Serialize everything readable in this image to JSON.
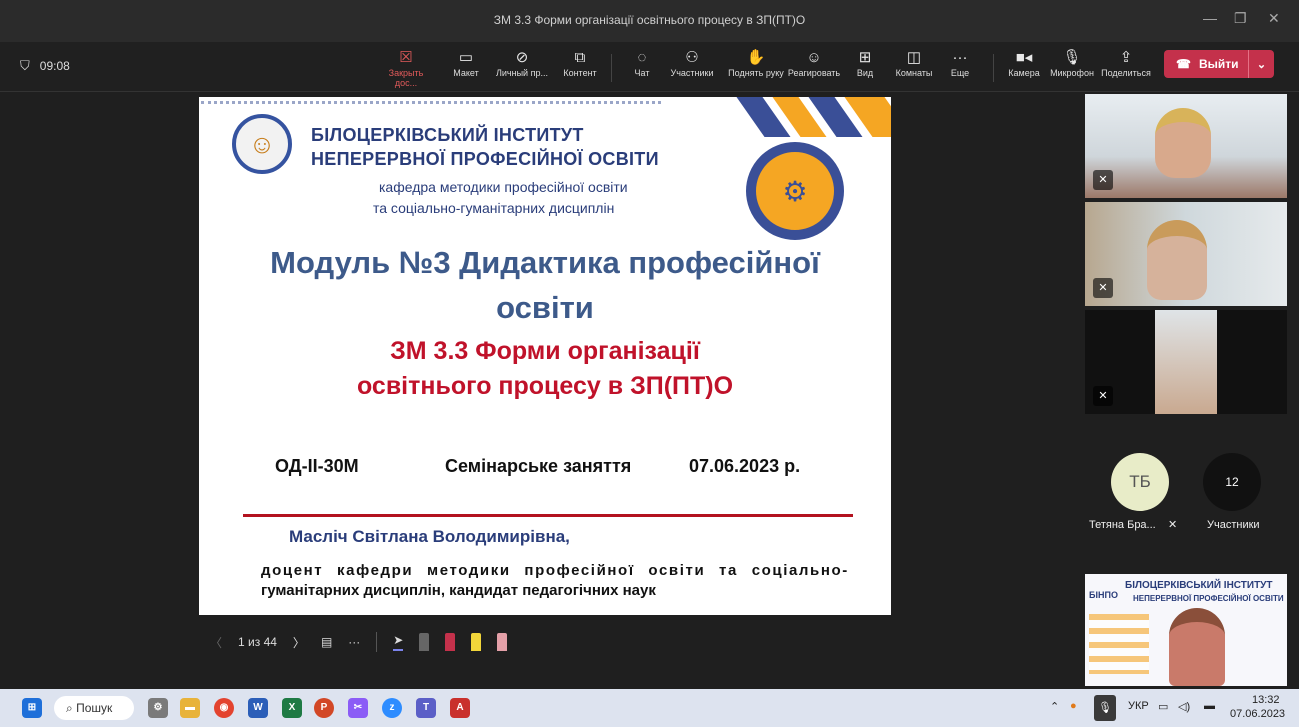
{
  "window": {
    "title": "ЗМ 3.3 Форми організації освітнього процесу в ЗП(ПТ)О"
  },
  "meeting": {
    "time": "09:08"
  },
  "toolbar": {
    "stop_share": "Закрыть дос...",
    "layout": "Макет",
    "personal": "Личный пр...",
    "content": "Контент",
    "chat": "Чат",
    "participants": "Участники",
    "raise_hand": "Поднять руку",
    "react": "Реагировать",
    "view": "Вид",
    "rooms": "Комнаты",
    "more": "Еще",
    "camera": "Камера",
    "mic": "Микрофон",
    "share": "Поделиться",
    "leave": "Выйти"
  },
  "slide": {
    "institute_line1": "БІЛОЦЕРКІВСЬКИЙ ІНСТИТУТ",
    "institute_line2": "НЕПЕРЕРВНОЇ ПРОФЕСІЙНОЇ ОСВІТИ",
    "dept_line1": "кафедра методики професійної освіти",
    "dept_line2": "та соціально-гуманітарних дисциплін",
    "module_line1": "Модуль №3 Дидактика професійної",
    "module_line2": "освіти",
    "zm_line1": "ЗМ 3.3 Форми організації",
    "zm_line2": "освітнього процесу в ЗП(ПТ)О",
    "group": "ОД-ІІ-30М",
    "session": "Семінарське заняття",
    "date": "07.06.2023 р.",
    "author": "Масліч Світлана Володимирівна,",
    "position_line1": "доцент кафедри методики професійної освіти та соціально-",
    "position_line2": "гуманітарних дисциплін, кандидат педагогічних наук"
  },
  "slide_nav": {
    "page": "1 из 44"
  },
  "participants_panel": {
    "avatar_initials": "ТБ",
    "participant_name": "Тетяна Бра...",
    "count": "12",
    "count_label": "Участники",
    "thumb_line1": "БІЛОЦЕРКІВСЬКИЙ ІНСТИТУТ",
    "thumb_line2": "НЕПЕРЕРВНОЇ ПРОФЕСІЙНОЇ ОСВІТИ",
    "thumb_logo": "БІНПО"
  },
  "taskbar": {
    "search": "Пошук",
    "lang": "УКР",
    "time": "13:32",
    "date": "07.06.2023"
  },
  "colors": {
    "leave": "#c4314b",
    "slide_red": "#c0122a",
    "slide_blue": "#2a3d7a"
  }
}
